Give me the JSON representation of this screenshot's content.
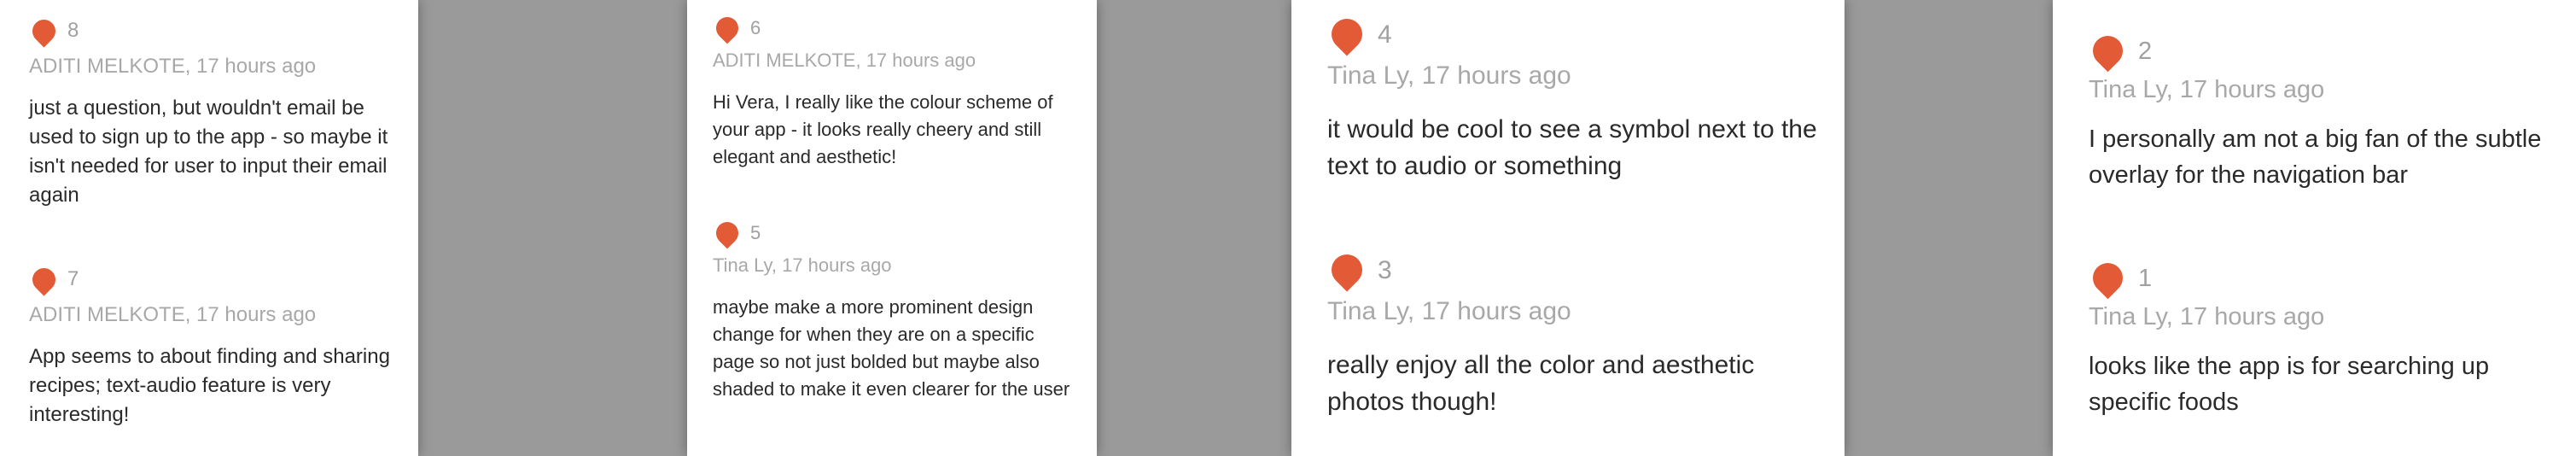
{
  "accent_color": "#e35a36",
  "panels": [
    {
      "comments": [
        {
          "number": "8",
          "meta": "ADITI MELKOTE, 17 hours ago",
          "text": "just a question, but wouldn't email be used to sign up to the app - so maybe it isn't needed for user to input their email again"
        },
        {
          "number": "7",
          "meta": "ADITI MELKOTE, 17 hours ago",
          "text": "App seems to about finding and sharing recipes; text-audio feature is very interesting!"
        }
      ]
    },
    {
      "comments": [
        {
          "number": "6",
          "meta": "ADITI MELKOTE, 17 hours ago",
          "text": "Hi Vera, I really like the colour scheme of your app - it looks really cheery and still elegant and aesthetic!"
        },
        {
          "number": "5",
          "meta": "Tina Ly, 17 hours ago",
          "text": "maybe make a more prominent design change for when they are on a specific page so not just bolded but maybe also shaded to make it even clearer for the user"
        }
      ]
    },
    {
      "comments": [
        {
          "number": "4",
          "meta": "Tina Ly, 17 hours ago",
          "text": "it would be cool to see a symbol next to the text to audio or something"
        },
        {
          "number": "3",
          "meta": "Tina Ly, 17 hours ago",
          "text": "really enjoy all the color and aesthetic photos though!"
        }
      ]
    },
    {
      "comments": [
        {
          "number": "2",
          "meta": "Tina Ly, 17 hours ago",
          "text": "I personally am not a big fan of the subtle overlay for the navigation bar"
        },
        {
          "number": "1",
          "meta": "Tina Ly, 17 hours ago",
          "text": "looks like the app is for searching up specific foods"
        }
      ]
    }
  ]
}
